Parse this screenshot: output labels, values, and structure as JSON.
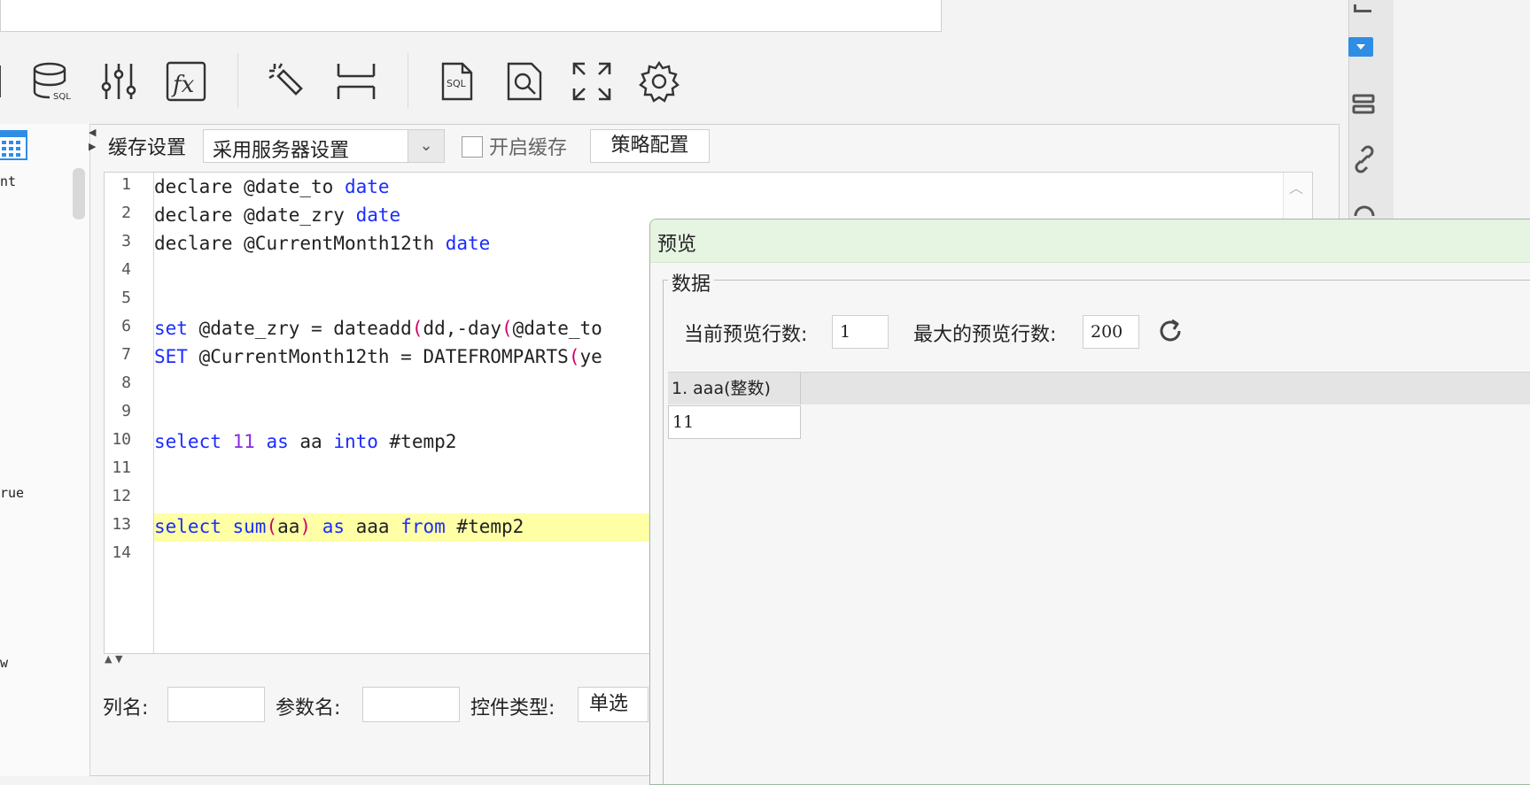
{
  "toolbar": {
    "icons": [
      "database-sql-icon",
      "sliders-icon",
      "function-fx-icon",
      "magic-wand-icon",
      "row-height-icon",
      "sql-file-icon",
      "preview-search-icon",
      "fullscreen-icon",
      "gear-icon"
    ]
  },
  "left_panel": {
    "fragments": [
      "nt",
      "rue",
      "w"
    ]
  },
  "cache": {
    "label": "缓存设置",
    "select_value": "采用服务器设置",
    "enable_label": "开启缓存",
    "strategy_button": "策略配置"
  },
  "editor": {
    "line_numbers": [
      "1",
      "2",
      "3",
      "4",
      "5",
      "6",
      "7",
      "8",
      "9",
      "10",
      "11",
      "12",
      "13",
      "14"
    ],
    "line1": {
      "kw1": "declare",
      "var": " @date_to ",
      "kw2": "date"
    },
    "line2": {
      "kw1": "declare",
      "var": " @date_zry ",
      "kw2": "date"
    },
    "line3": {
      "kw1": "declare",
      "var": " @CurrentMonth12th ",
      "kw2": "date"
    },
    "line6": {
      "kw": "set",
      "rest1": " @date_zry = dateadd",
      "p1": "(",
      "rest2": "dd,-day",
      "p2": "(",
      "rest3": "@date_to"
    },
    "line7": {
      "kw": "SET",
      "rest1": " @CurrentMonth12th = DATEFROMPARTS",
      "p1": "(",
      "rest2": "ye"
    },
    "line10": {
      "kw1": "select",
      "num": " 11",
      "kw2": " as",
      "t1": " aa",
      "kw3": " into",
      "t2": " #temp2"
    },
    "line13": {
      "kw1": "select",
      "fn": " sum",
      "p1": "(",
      "t1": "aa",
      "p2": ")",
      "kw2": " as",
      "t2": " aaa",
      "kw3": " from",
      "t3": " #temp2"
    }
  },
  "bottom_fields": {
    "column_label": "列名:",
    "param_label": "参数名:",
    "control_type_label": "控件类型:",
    "control_type_value": "单选"
  },
  "preview": {
    "title": "预览",
    "group": "数据",
    "current_rows_label": "当前预览行数:",
    "current_rows_value": "1",
    "max_rows_label": "最大的预览行数:",
    "max_rows_value": "200",
    "columns": [
      "1.  aaa(整数)"
    ],
    "rows": [
      [
        "11"
      ]
    ]
  }
}
